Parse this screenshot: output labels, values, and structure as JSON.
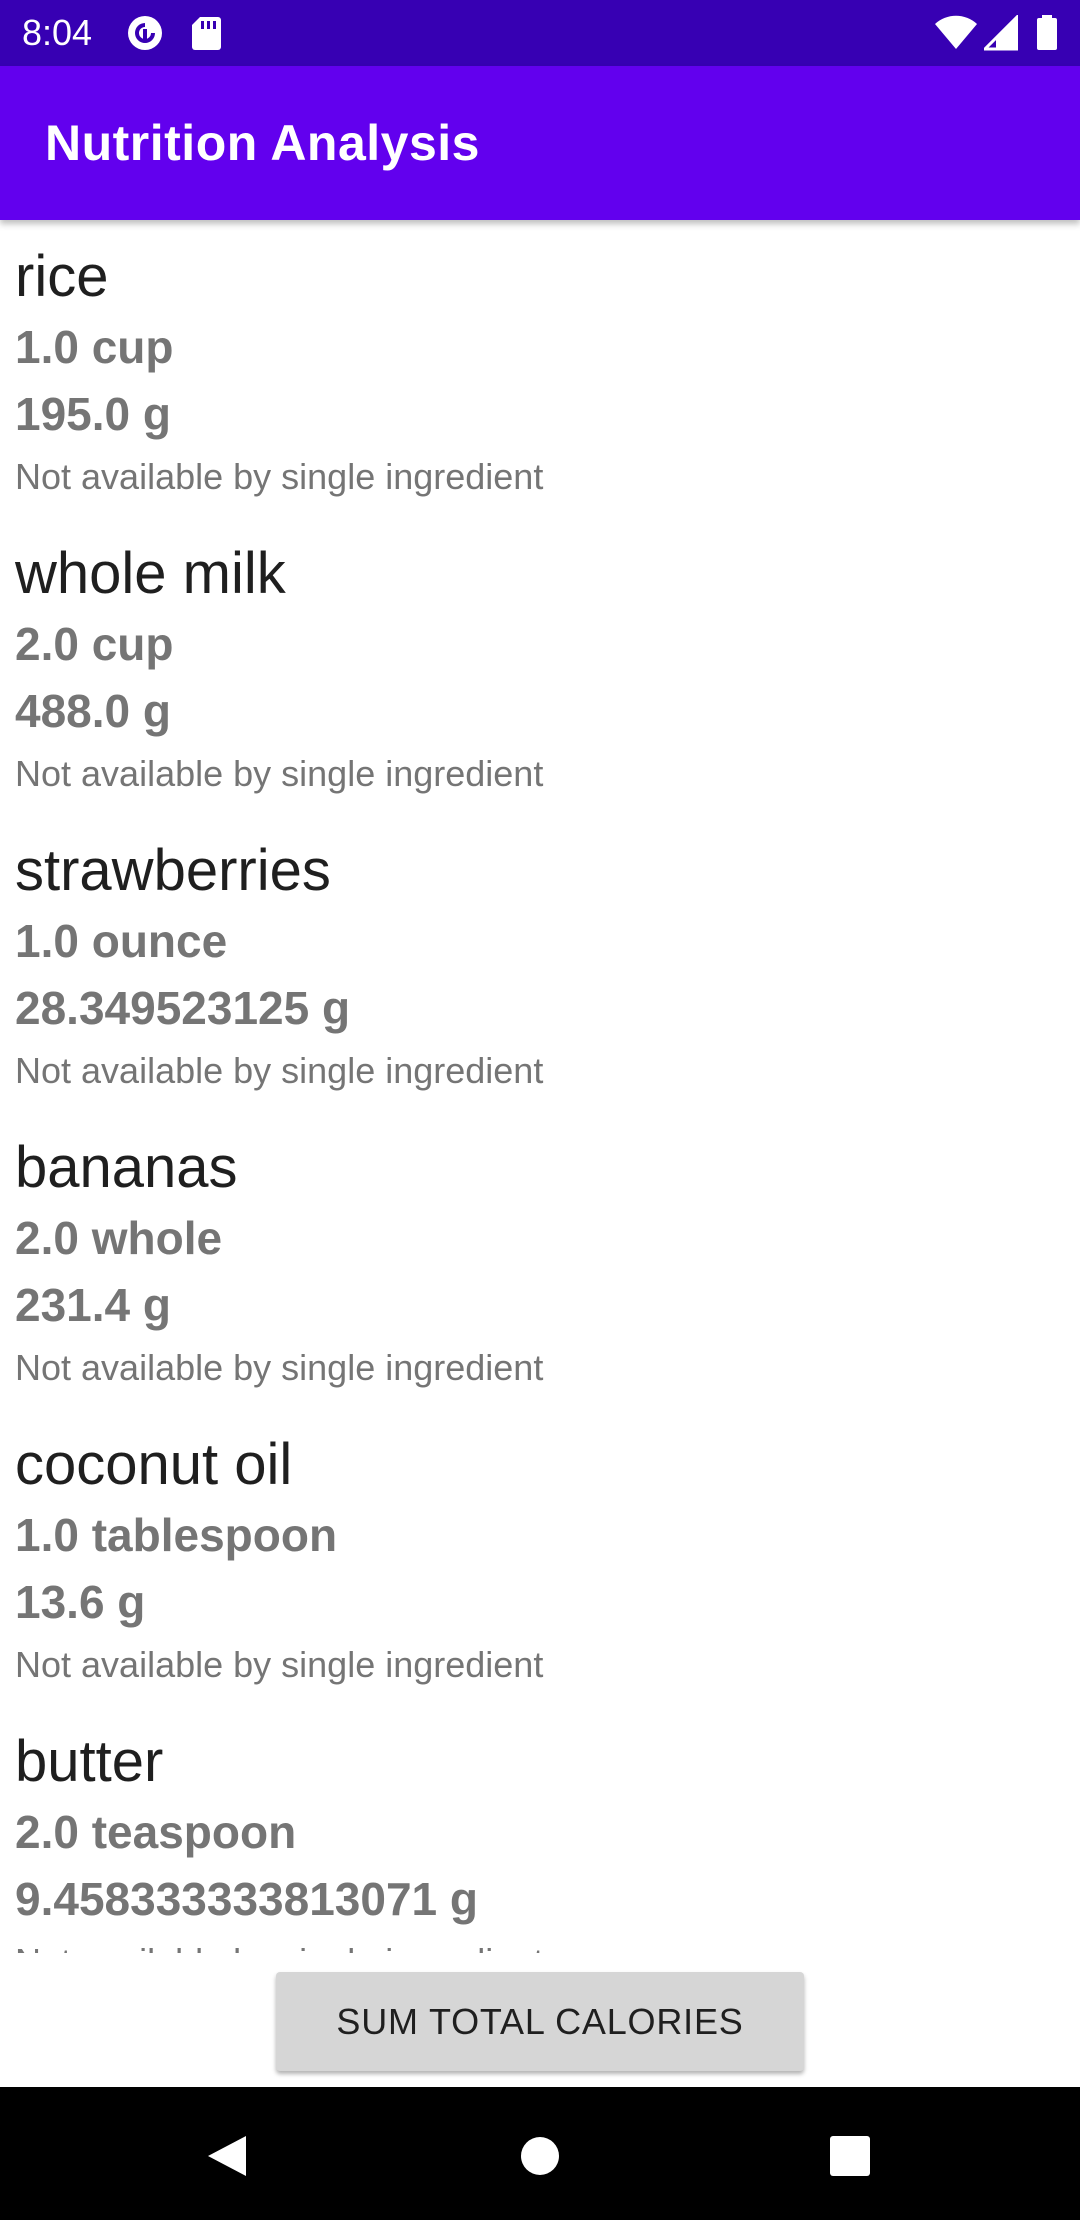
{
  "status_bar": {
    "time": "8:04",
    "background_color": "#3700b3",
    "left_icons": [
      "pocket-casts-icon",
      "sd-card-icon"
    ],
    "right_icons": [
      "wifi-icon",
      "signal-icon",
      "battery-icon"
    ]
  },
  "app_bar": {
    "title": "Nutrition Analysis",
    "background_color": "#6200ee"
  },
  "ingredients": [
    {
      "name": "rice",
      "quantity": "1.0 cup",
      "weight": "195.0 g",
      "calories": "Not available by single ingredient"
    },
    {
      "name": "whole milk",
      "quantity": "2.0 cup",
      "weight": "488.0 g",
      "calories": "Not available by single ingredient"
    },
    {
      "name": "strawberries",
      "quantity": "1.0 ounce",
      "weight": "28.349523125 g",
      "calories": "Not available by single ingredient"
    },
    {
      "name": "bananas",
      "quantity": "2.0 whole",
      "weight": "231.4 g",
      "calories": "Not available by single ingredient"
    },
    {
      "name": "coconut oil",
      "quantity": "1.0 tablespoon",
      "weight": "13.6 g",
      "calories": "Not available by single ingredient"
    },
    {
      "name": "butter",
      "quantity": "2.0 teaspoon",
      "weight": "9.458333333813071 g",
      "calories": "Not available by single ingredient"
    }
  ],
  "sum_button": {
    "label": "SUM TOTAL CALORIES"
  },
  "nav_bar": {
    "icons": [
      "back-icon",
      "home-icon",
      "recents-icon"
    ]
  }
}
